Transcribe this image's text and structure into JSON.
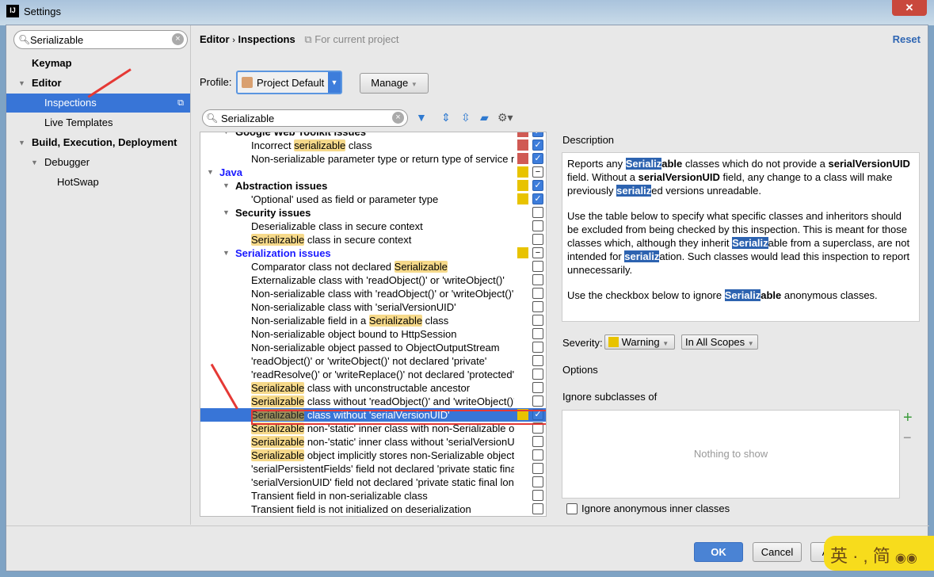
{
  "window": {
    "title": "Settings",
    "close": "✕"
  },
  "sidebar": {
    "search": "Serializable",
    "items": [
      {
        "label": "Keymap",
        "bold": true,
        "level": 0,
        "tri": false
      },
      {
        "label": "Editor",
        "bold": true,
        "level": 0,
        "tri": true
      },
      {
        "label": "Inspections",
        "bold": false,
        "level": 1,
        "tri": false,
        "selected": true
      },
      {
        "label": "Live Templates",
        "bold": false,
        "level": 1,
        "tri": false
      },
      {
        "label": "Build, Execution, Deployment",
        "bold": true,
        "level": 0,
        "tri": true
      },
      {
        "label": "Debugger",
        "bold": false,
        "level": 1,
        "tri": true
      },
      {
        "label": "HotSwap",
        "bold": false,
        "level": 2,
        "tri": false
      }
    ]
  },
  "header": {
    "crumb1": "Editor",
    "sep": "›",
    "crumb2": "Inspections",
    "scope": "For current project",
    "reset": "Reset"
  },
  "profile": {
    "label": "Profile:",
    "value": "Project Default",
    "manage": "Manage"
  },
  "filter": {
    "value": "Serializable"
  },
  "colors": {
    "error": "#d05a54",
    "warning": "#e8c300",
    "selection": "#3875d7"
  },
  "tree": [
    {
      "level": 1,
      "group": true,
      "pre": "Google Web Toolkit issues",
      "sev": "error",
      "cb": "on"
    },
    {
      "level": 2,
      "pre": "Incorrect ",
      "hl": "serializable",
      "post": " class",
      "sev": "error",
      "cb": "on"
    },
    {
      "level": 2,
      "pre": "Non-serializable parameter type or return type of service me",
      "sev": "error",
      "cb": "on"
    },
    {
      "level": 0,
      "group": true,
      "blue": true,
      "pre": "Java",
      "sev": "warning",
      "cb": "mixed"
    },
    {
      "level": 1,
      "group": true,
      "pre": "Abstraction issues",
      "sev": "warning",
      "cb": "on"
    },
    {
      "level": 2,
      "pre": "'Optional' used as field or parameter type",
      "sev": "warning",
      "cb": "on"
    },
    {
      "level": 1,
      "group": true,
      "pre": "Security issues",
      "cb": "off"
    },
    {
      "level": 2,
      "pre": "Deserializable class in secure context",
      "cb": "off"
    },
    {
      "level": 2,
      "hl": "Serializable",
      "post": " class in secure context",
      "cb": "off"
    },
    {
      "level": 1,
      "group": true,
      "blue": true,
      "pre": "Serialization issues",
      "sev": "warning",
      "cb": "mixed"
    },
    {
      "level": 2,
      "pre": "Comparator class not declared ",
      "hl": "Serializable",
      "cb": "off"
    },
    {
      "level": 2,
      "pre": "Externalizable class with 'readObject()' or 'writeObject()'",
      "cb": "off"
    },
    {
      "level": 2,
      "pre": "Non-serializable class with 'readObject()' or 'writeObject()'",
      "cb": "off"
    },
    {
      "level": 2,
      "pre": "Non-serializable class with 'serialVersionUID'",
      "cb": "off"
    },
    {
      "level": 2,
      "pre": "Non-serializable field in a ",
      "hl": "Serializable",
      "post": " class",
      "cb": "off"
    },
    {
      "level": 2,
      "pre": "Non-serializable object bound to HttpSession",
      "cb": "off"
    },
    {
      "level": 2,
      "pre": "Non-serializable object passed to ObjectOutputStream",
      "cb": "off"
    },
    {
      "level": 2,
      "pre": "'readObject()' or 'writeObject()' not declared 'private'",
      "cb": "off"
    },
    {
      "level": 2,
      "pre": "'readResolve()' or 'writeReplace()' not declared 'protected'",
      "cb": "off"
    },
    {
      "level": 2,
      "hl": "Serializable",
      "post": " class with unconstructable ancestor",
      "cb": "off"
    },
    {
      "level": 2,
      "hl": "Serializable",
      "post": " class without 'readObject()' and 'writeObject()'",
      "cb": "off"
    },
    {
      "level": 2,
      "hl": "Serializable",
      "post": " class without 'serialVersionUID'",
      "sev": "warning",
      "cb": "on",
      "selected": true
    },
    {
      "level": 2,
      "hl": "Serializable",
      "post": " non-'static' inner class with non-Serializable outer",
      "cb": "off"
    },
    {
      "level": 2,
      "hl": "Serializable",
      "post": " non-'static' inner class without 'serialVersionUID'",
      "cb": "off"
    },
    {
      "level": 2,
      "hl": "Serializable",
      "post": " object implicitly stores non-Serializable object",
      "cb": "off"
    },
    {
      "level": 2,
      "pre": "'serialPersistentFields' field not declared 'private static final'",
      "cb": "off"
    },
    {
      "level": 2,
      "pre": "'serialVersionUID' field not declared 'private static final long'",
      "cb": "off"
    },
    {
      "level": 2,
      "pre": "Transient field in non-serializable class",
      "cb": "off"
    },
    {
      "level": 2,
      "pre": "Transient field is not initialized on deserialization",
      "cb": "off"
    }
  ],
  "description": {
    "label": "Description",
    "paragraphs": [
      [
        [
          "",
          "Reports any "
        ],
        [
          "h",
          "Serializ"
        ],
        [
          "b",
          "able"
        ],
        [
          "",
          " classes which do not provide a "
        ],
        [
          "b",
          "serialVersionUID"
        ],
        [
          "",
          " field. Without a "
        ],
        [
          "b",
          "serialVersionUID"
        ],
        [
          "",
          " field, any change to a class will make previously "
        ],
        [
          "h",
          "serializ"
        ],
        [
          "",
          "ed versions unreadable."
        ]
      ],
      [
        [
          "",
          "Use the table below to specify what specific classes and inheritors should be excluded from being checked by this inspection. This is meant for those classes which, although they inherit "
        ],
        [
          "h",
          "Serializ"
        ],
        [
          "",
          "able from a superclass, are not intended for "
        ],
        [
          "h",
          "serializ"
        ],
        [
          "",
          "ation. Such classes would lead this inspection to report unnecessarily."
        ]
      ],
      [
        [
          "",
          "Use the checkbox below to ignore "
        ],
        [
          "h",
          "Serializ"
        ],
        [
          "b",
          "able"
        ],
        [
          "",
          " anonymous classes."
        ]
      ]
    ]
  },
  "severity": {
    "label": "Severity:",
    "value": "Warning",
    "scope": "In All Scopes"
  },
  "options": {
    "label": "Options",
    "ignore_subclasses": "Ignore subclasses of",
    "empty": "Nothing to show",
    "add": "+",
    "remove": "−",
    "ignore_anon": "Ignore anonymous inner classes"
  },
  "footer": {
    "ok": "OK",
    "cancel": "Cancel",
    "apply": "Apply"
  },
  "ime": {
    "text": "英 · , 简"
  }
}
